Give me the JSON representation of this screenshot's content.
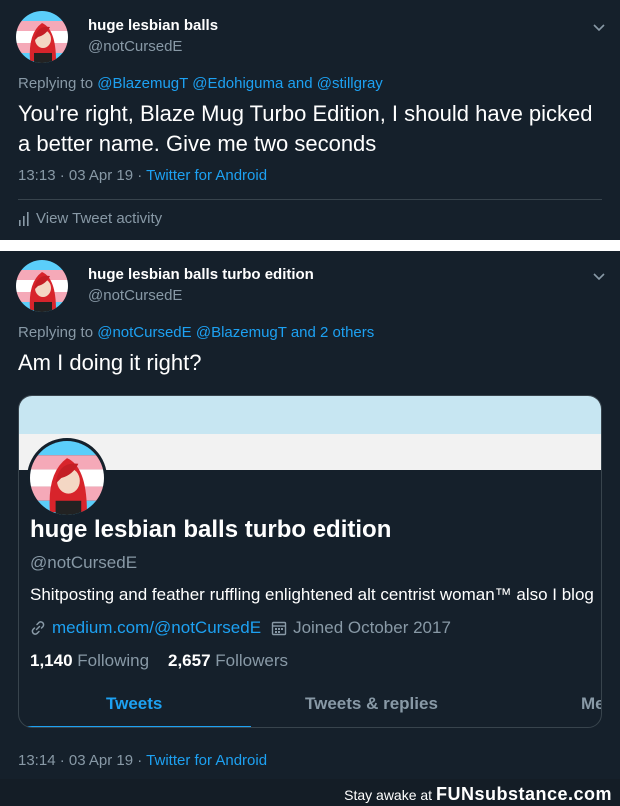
{
  "tweet1": {
    "name": "huge lesbian balls",
    "handle": "@notCursedE",
    "replying_prefix": "Replying to",
    "replying_users": [
      "@BlazemugT",
      "@Edohiguma"
    ],
    "replying_and": "and",
    "replying_last": "@stillgray",
    "text": "You're right, Blaze Mug Turbo Edition, I should have picked a better name. Give me two seconds",
    "time": "13:13 · 03 Apr 19 ·",
    "client": "Twitter for Android",
    "activity": "View Tweet activity"
  },
  "tweet2": {
    "name": "huge lesbian balls turbo edition",
    "handle": "@notCursedE",
    "replying_prefix": "Replying to",
    "replying_users": [
      "@notCursedE",
      "@BlazemugT"
    ],
    "replying_and": "and",
    "replying_last": "2 others",
    "text": "Am I doing it right?",
    "time": "13:14 · 03 Apr 19 ·",
    "client": "Twitter for Android"
  },
  "profile_card": {
    "name": "huge lesbian balls turbo edition",
    "handle": "@notCursedE",
    "bio": "Shitposting and feather ruffling enlightened alt centrist woman™ also I blog",
    "website": "medium.com/@notCursedE",
    "joined": "Joined October 2017",
    "following_count": "1,140",
    "following_label": "Following",
    "followers_count": "2,657",
    "followers_label": "Followers",
    "tabs": [
      "Tweets",
      "Tweets & replies",
      "Me"
    ]
  },
  "watermark": {
    "prefix": "Stay awake at",
    "brand": "FUNsubstance.com"
  },
  "colors": {
    "background": "#15202b",
    "accent": "#1da1f2",
    "muted": "#8899a6"
  }
}
